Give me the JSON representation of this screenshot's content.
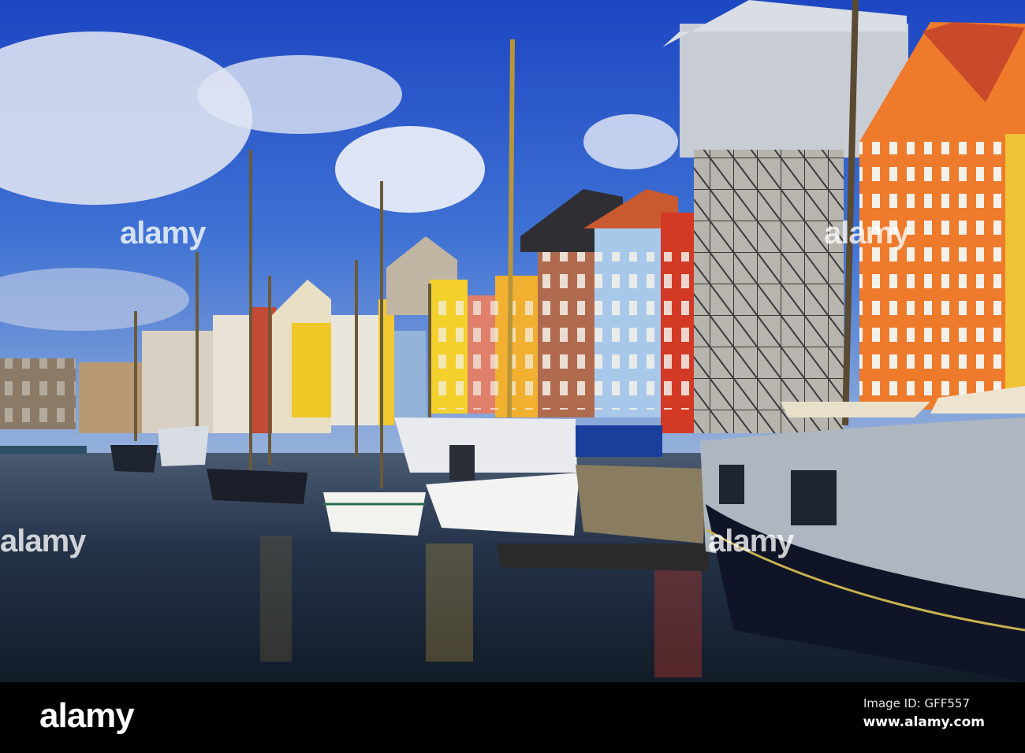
{
  "watermark": {
    "text": "alamy"
  },
  "footer": {
    "logo": "alamy",
    "image_id": "Image ID: GFF557",
    "website": "www.alamy.com"
  },
  "colors": {
    "sky_top": "#1f4fc9",
    "sky_bottom": "#8fb0de",
    "water": "#1c2a3c",
    "bar": "#000000"
  }
}
